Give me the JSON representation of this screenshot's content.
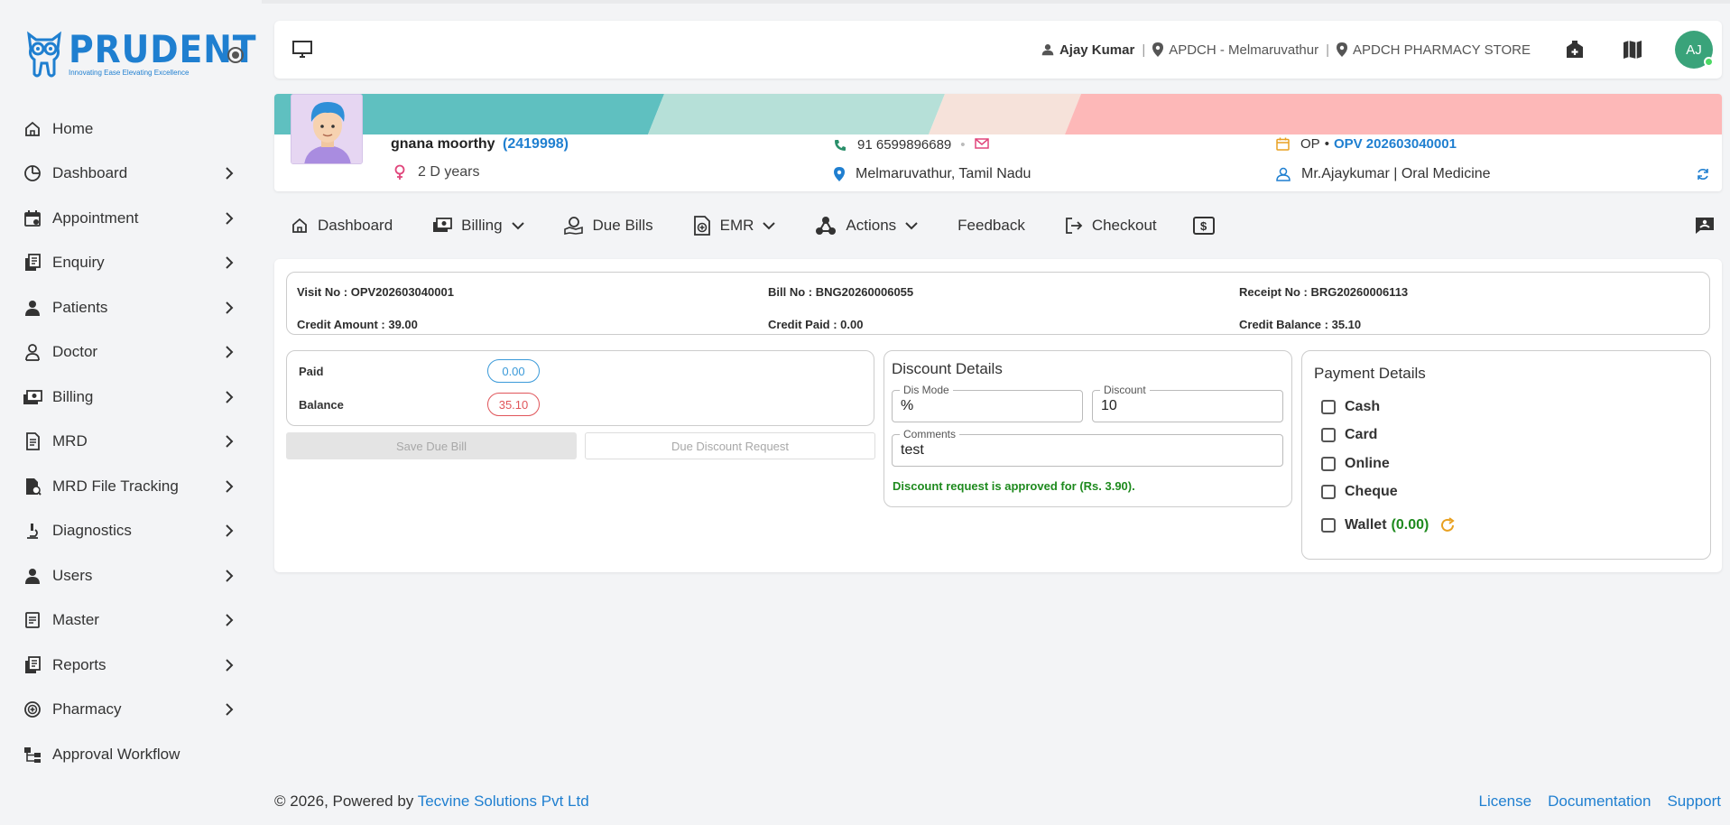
{
  "brand": {
    "name": "PRUDENT",
    "tagline": "Innovating Ease Elevating Excellence",
    "primary_color": "#1f7fd0"
  },
  "sidebar": {
    "items": [
      {
        "label": "Home",
        "icon": "home-icon",
        "has_submenu": false
      },
      {
        "label": "Dashboard",
        "icon": "clock-icon",
        "has_submenu": true
      },
      {
        "label": "Appointment",
        "icon": "calendar-icon",
        "has_submenu": true
      },
      {
        "label": "Enquiry",
        "icon": "documents-icon",
        "has_submenu": true
      },
      {
        "label": "Patients",
        "icon": "person-icon",
        "has_submenu": true
      },
      {
        "label": "Doctor",
        "icon": "doctor-icon",
        "has_submenu": true
      },
      {
        "label": "Billing",
        "icon": "money-icon",
        "has_submenu": true
      },
      {
        "label": "MRD",
        "icon": "file-icon",
        "has_submenu": true
      },
      {
        "label": "MRD File Tracking",
        "icon": "file-tracking-icon",
        "has_submenu": true
      },
      {
        "label": "Diagnostics",
        "icon": "microscope-icon",
        "has_submenu": true
      },
      {
        "label": "Users",
        "icon": "user-icon",
        "has_submenu": true
      },
      {
        "label": "Master",
        "icon": "list-icon",
        "has_submenu": true
      },
      {
        "label": "Reports",
        "icon": "reports-icon",
        "has_submenu": true
      },
      {
        "label": "Pharmacy",
        "icon": "pharmacy-icon",
        "has_submenu": true
      },
      {
        "label": "Approval Workflow",
        "icon": "workflow-icon",
        "has_submenu": false
      }
    ]
  },
  "header": {
    "user": "Ajay Kumar",
    "location": "APDCH - Melmaruvathur",
    "store": "APDCH PHARMACY STORE",
    "avatar_initials": "AJ"
  },
  "patient": {
    "name": "gnana moorthy",
    "id": "(2419998)",
    "age": "2 D years",
    "phone": "91 6599896689",
    "address": "Melmaruvathur, Tamil Nadu",
    "visit_type": "OP",
    "visit_no": "OPV 202603040001",
    "doctor": "Mr.Ajaykumar | Oral Medicine"
  },
  "toolbar": {
    "dashboard": "Dashboard",
    "billing": "Billing",
    "due_bills": "Due Bills",
    "emr": "EMR",
    "actions": "Actions",
    "feedback": "Feedback",
    "checkout": "Checkout",
    "dollar": "$"
  },
  "visit_info": {
    "visit_no": "Visit No : OPV202603040001",
    "bill_no": "Bill No : BNG20260006055",
    "receipt_no": "Receipt No : BRG20260006113",
    "credit_amount": "Credit Amount : 39.00",
    "credit_paid": "Credit Paid : 0.00",
    "credit_balance": "Credit Balance : 35.10"
  },
  "due": {
    "paid_label": "Paid",
    "paid_value": "0.00",
    "balance_label": "Balance",
    "balance_value": "35.10",
    "save_button": "Save Due Bill",
    "discount_request_button": "Due Discount Request"
  },
  "discount": {
    "title": "Discount Details",
    "mode_label": "Dis Mode",
    "mode_value": "%",
    "discount_label": "Discount",
    "discount_value": "10",
    "comments_label": "Comments",
    "comments_value": "test",
    "approved_message": "Discount request is approved for (Rs. 3.90)."
  },
  "payment": {
    "title": "Payment Details",
    "options": [
      "Cash",
      "Card",
      "Online",
      "Cheque"
    ],
    "wallet_label": "Wallet",
    "wallet_amount": "(0.00)"
  },
  "footer": {
    "prefix": "© 2026, Powered by",
    "company": "Tecvine Solutions Pvt Ltd",
    "links": [
      "License",
      "Documentation",
      "Support"
    ]
  }
}
